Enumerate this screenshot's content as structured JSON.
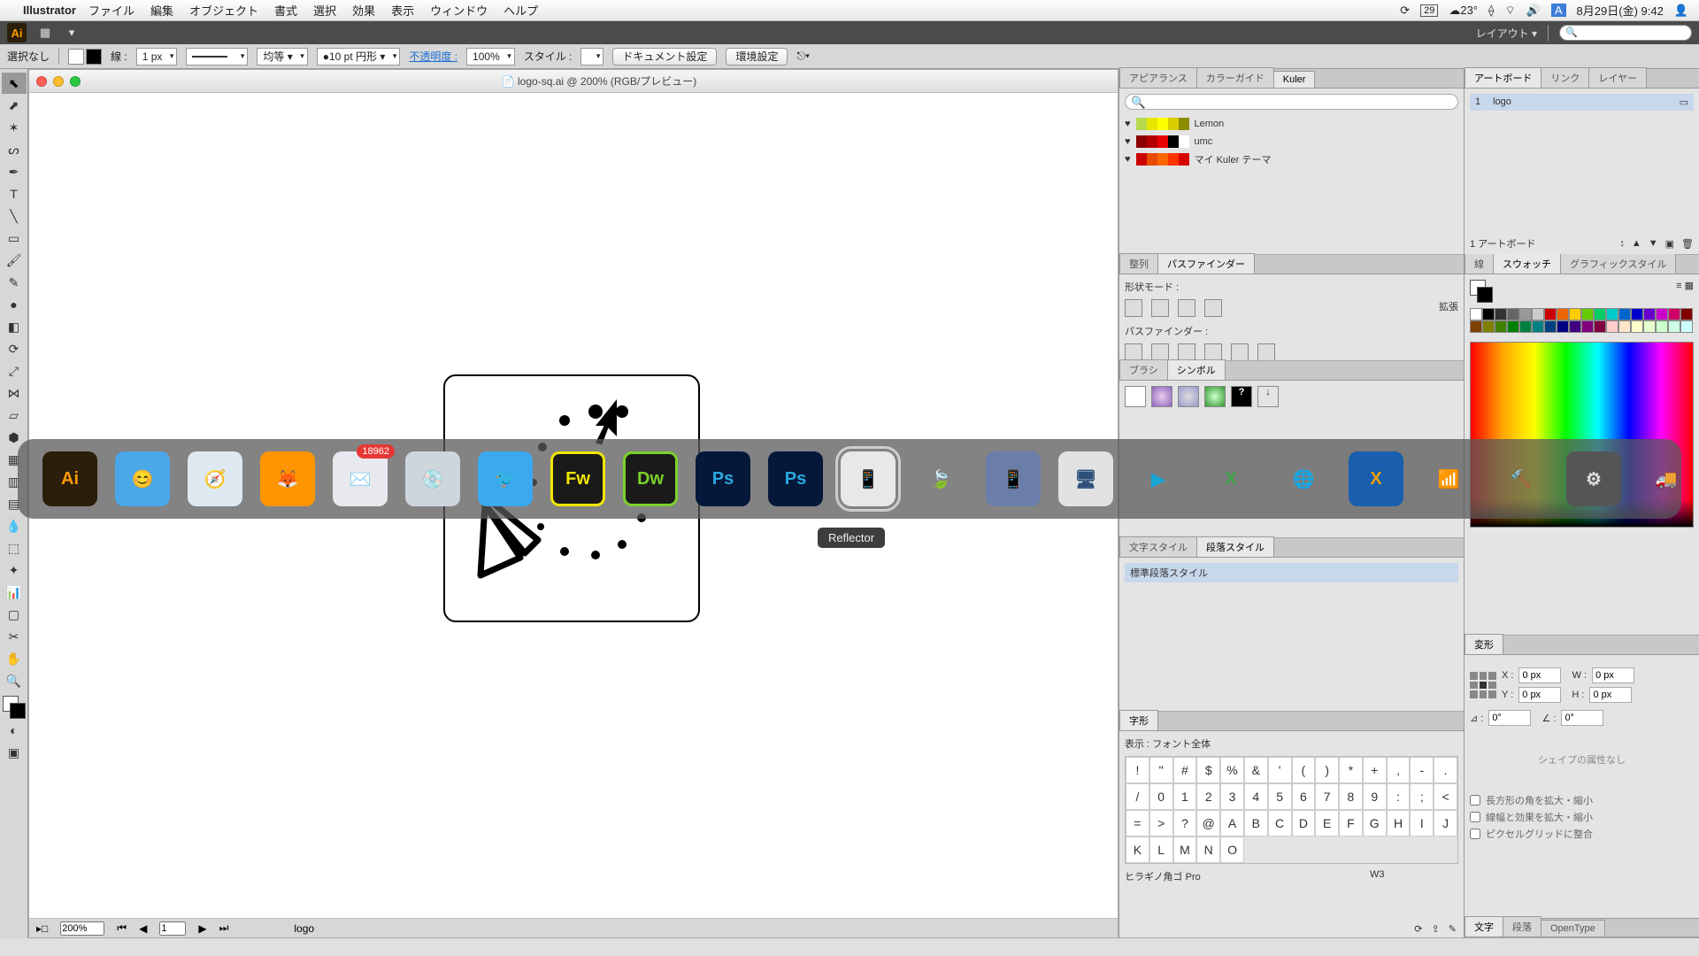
{
  "os_menu": {
    "app_name": "Illustrator",
    "items": [
      "ファイル",
      "編集",
      "オブジェクト",
      "書式",
      "選択",
      "効果",
      "表示",
      "ウィンドウ",
      "ヘルプ"
    ],
    "temp": "23°",
    "calendar_day": "29",
    "input_badge": "A",
    "clock": "8月29日(金)  9:42"
  },
  "app_header": {
    "layout_label": "レイアウト ▾",
    "search_placeholder": "🔍"
  },
  "control_bar": {
    "no_selection": "選択なし",
    "stroke_label": "線 :",
    "stroke_weight": "1 px",
    "uniform": "均等 ▾",
    "pt_shape": "10 pt  円形 ▾",
    "opacity_label": "不透明度 :",
    "opacity_value": "100%",
    "style_label": "スタイル :",
    "doc_setup": "ドキュメント設定",
    "prefs": "環境設定"
  },
  "doc": {
    "title": "logo-sq.ai @ 200% (RGB/プレビュー)",
    "zoom": "200%",
    "page": "1",
    "artboard_name": "logo"
  },
  "panels": {
    "kuler_tabs": [
      "アピアランス",
      "カラーガイド",
      "Kuler"
    ],
    "kuler_search_placeholder": "🔍",
    "kuler_rows": [
      "Lemon",
      "umc",
      "マイ Kuler テーマ"
    ],
    "kuler_colors": [
      [
        "#b6d94c",
        "#e6e600",
        "#ffff00",
        "#d9cc00",
        "#8c8c00"
      ],
      [
        "#8c0000",
        "#b30000",
        "#e60000",
        "#000",
        "#fff"
      ],
      [
        "#cc0000",
        "#e64d00",
        "#ff6600",
        "#ff3300",
        "#d90000"
      ]
    ],
    "align_tabs": [
      "整列",
      "パスファインダー"
    ],
    "shape_mode": "形状モード :",
    "expand": "拡張",
    "pathfinder": "パスファインダー :",
    "brush_tabs": [
      "ブラシ",
      "シンボル"
    ],
    "charstyle_tabs": [
      "文字スタイル",
      "段落スタイル"
    ],
    "default_para": "標準段落スタイル",
    "glyph_tab": "字形",
    "glyph_show_label": "表示 :",
    "glyph_show_value": "フォント全体",
    "glyph_chars": [
      "!",
      "\"",
      "#",
      "$",
      "%",
      "&",
      "'",
      "(",
      ")",
      "*",
      "+",
      ",",
      "-",
      ".",
      "/",
      "0",
      "1",
      "2",
      "3",
      "4",
      "5",
      "6",
      "7",
      "8",
      "9",
      ":",
      ";",
      "<",
      "=",
      ">",
      "?",
      "@",
      "A",
      "B",
      "C",
      "D",
      "E",
      "F",
      "G",
      "H",
      "I",
      "J",
      "K",
      "L",
      "M",
      "N",
      "O"
    ],
    "font_family": "ヒラギノ角ゴ Pro",
    "font_style": "W3"
  },
  "right_side": {
    "artboard_tabs": [
      "アートボード",
      "リンク",
      "レイヤー"
    ],
    "artboard_row_index": "1",
    "artboard_row_name": "logo",
    "artboard_count": "1 アートボード",
    "swatch_tabs": [
      "線",
      "スウォッチ",
      "グラフィックスタイル"
    ],
    "transform_tab": "変形",
    "x": "0 px",
    "y": "0 px",
    "w": "0 px",
    "h": "0 px",
    "angle": "0°",
    "shear": "0°",
    "no_shape_attr": "シェイプの属性なし",
    "chk1": "長方形の角を拡大・縮小",
    "chk2": "線幅と効果を拡大・縮小",
    "chk3": "ピクセルグリッドに整合",
    "type_tabs": [
      "文字",
      "段落",
      "OpenType"
    ]
  },
  "dock": {
    "tip": "Reflector",
    "badge_mail": "18962",
    "apps": [
      {
        "name": "Illustrator",
        "bg": "#2b1e0b",
        "fg": "#ff9a00",
        "text": "Ai"
      },
      {
        "name": "Finder",
        "bg": "#4aa7e8",
        "fg": "#fff",
        "text": "😊"
      },
      {
        "name": "Safari",
        "bg": "#dfe9f2",
        "fg": "#2a6bd4",
        "text": "🧭"
      },
      {
        "name": "Firefox",
        "bg": "#ff9500",
        "fg": "#1165c7",
        "text": "🦊"
      },
      {
        "name": "Mail",
        "bg": "#e8e8ef",
        "fg": "#5a6b9e",
        "text": "✉️",
        "badge": true
      },
      {
        "name": "Disc",
        "bg": "#cfd5dc",
        "fg": "#667",
        "text": "💿"
      },
      {
        "name": "Twitter",
        "bg": "#3ba9ee",
        "fg": "#fff",
        "text": "🐦"
      },
      {
        "name": "Fireworks",
        "bg": "#1a1a1a",
        "fg": "#f2e600",
        "text": "Fw",
        "outline": "#f2e600"
      },
      {
        "name": "Dreamweaver",
        "bg": "#1a1a1a",
        "fg": "#7bd12a",
        "text": "Dw",
        "outline": "#7bd12a"
      },
      {
        "name": "Photoshop",
        "bg": "#05183a",
        "fg": "#29a8df",
        "text": "Ps"
      },
      {
        "name": "Photoshop2",
        "bg": "#05183a",
        "fg": "#29a8df",
        "text": "Ps"
      },
      {
        "name": "Reflector",
        "bg": "#e8e8e8",
        "fg": "#d94a86",
        "text": "📱",
        "sel": true
      },
      {
        "name": "Leaf",
        "bg": "transparent",
        "fg": "#5bbf3b",
        "text": "🍃"
      },
      {
        "name": "Tablet",
        "bg": "#6b7eaa",
        "fg": "#fff",
        "text": "📱"
      },
      {
        "name": "Monitor",
        "bg": "#e2e2e2",
        "fg": "#2d4f7a",
        "text": "🖥"
      },
      {
        "name": "QuickTime",
        "bg": "transparent",
        "fg": "#17a6d6",
        "text": "▶"
      },
      {
        "name": "Excel",
        "bg": "transparent",
        "fg": "#3fa648",
        "text": "X"
      },
      {
        "name": "Chrome",
        "bg": "transparent",
        "fg": "#f2b90f",
        "text": "🌐"
      },
      {
        "name": "BoxExcel",
        "bg": "#1a5fad",
        "fg": "#f29f05",
        "text": "X"
      },
      {
        "name": "WiFi",
        "bg": "transparent",
        "fg": "#27a6d9",
        "text": "📶"
      },
      {
        "name": "Xcode",
        "bg": "transparent",
        "fg": "#4a8fd6",
        "text": "🔨"
      },
      {
        "name": "Settings",
        "bg": "#555",
        "fg": "#ddd",
        "text": "⚙"
      },
      {
        "name": "Truck",
        "bg": "transparent",
        "fg": "#e6a817",
        "text": "🚚"
      }
    ]
  }
}
